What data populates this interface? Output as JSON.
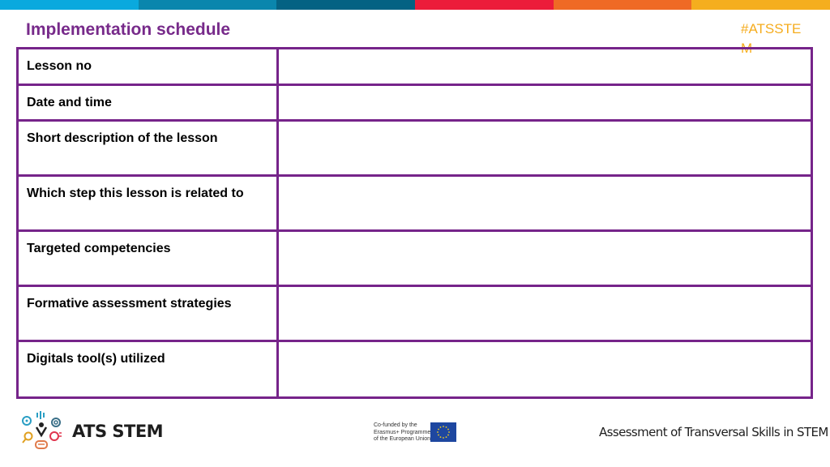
{
  "header": {
    "stripe_colors": [
      "#0aa9de",
      "#0a86ad",
      "#046283",
      "#ec1c3a",
      "#ef6a25",
      "#f5ae1e"
    ],
    "title": "Implementation schedule",
    "hashtag": "#ATSSTEM",
    "title_color": "#772a8a",
    "hashtag_color": "#f5ac1e"
  },
  "table": {
    "border_color": "#76248a",
    "rows": [
      {
        "label": "Lesson no",
        "value": ""
      },
      {
        "label": "Date and time",
        "value": ""
      },
      {
        "label": "Short description of the lesson",
        "value": ""
      },
      {
        "label": "Which step this lesson is related to",
        "value": ""
      },
      {
        "label": "Targeted competencies",
        "value": ""
      },
      {
        "label": "Formative assessment strategies",
        "value": ""
      },
      {
        "label": "Digitals tool(s) utilized",
        "value": ""
      }
    ]
  },
  "footer": {
    "logo_text": "ATS STEM",
    "cofunded_lines": [
      "Co-funded by the",
      "Erasmus+ Programme",
      "of the European Union"
    ],
    "tagline": "Assessment of Transversal Skills in STEM"
  }
}
